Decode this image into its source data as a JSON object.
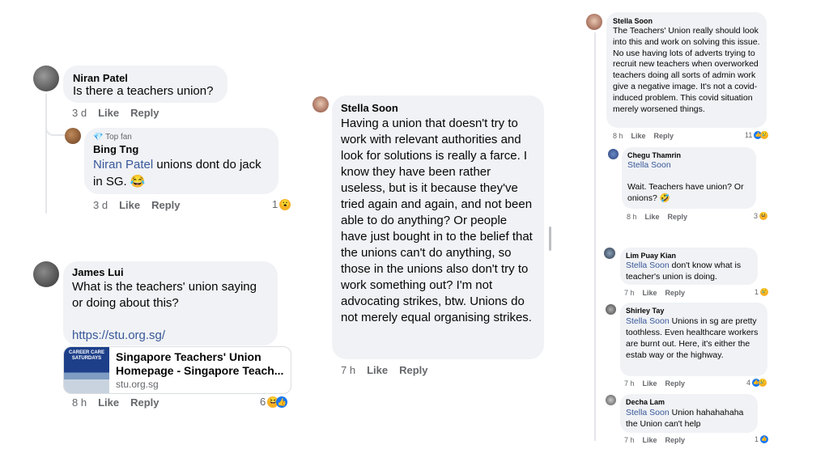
{
  "left": {
    "niran": {
      "name": "Niran Patel",
      "text": "Is there a teachers union?",
      "time": "3 d",
      "like": "Like",
      "reply": "Reply"
    },
    "bing": {
      "badge": "Top fan",
      "name": "Bing Tng",
      "mention": "Niran Patel",
      "text": " unions dont do jack in SG. 😂",
      "time": "3 d",
      "like": "Like",
      "reply": "Reply",
      "react_count": "1"
    },
    "james": {
      "name": "James Lui",
      "text": "What is the teachers' union saying or doing about this?",
      "url": "https://stu.org.sg/",
      "card_title": "Singapore Teachers' Union Homepage - Singapore Teach...",
      "card_domain": "stu.org.sg",
      "thumb_text": "CAREER CARE SATURDAYS",
      "time": "8 h",
      "like": "Like",
      "reply": "Reply",
      "react_count": "6"
    }
  },
  "middle": {
    "name": "Stella Soon",
    "text": "Having a union that doesn't try to work with relevant authorities and look for solutions is really a farce. I know they have been rather useless, but is it because they've tried again and again, and not been able to do anything? Or people have just bought in to the belief that the unions can't do anything, so those in the unions also don't try to work something out? I'm not advocating strikes, btw. Unions do not merely equal organising strikes.",
    "time": "7 h",
    "like": "Like",
    "reply": "Reply"
  },
  "right": {
    "stella": {
      "name": "Stella Soon",
      "text": "The Teachers' Union really should look into this and work on solving this issue. No use having lots of adverts trying to recruit new teachers when overworked teachers doing all sorts of admin work give a negative image. It's not a covid-induced problem. This covid situation merely worsened things.",
      "time": "8 h",
      "like": "Like",
      "reply": "Reply",
      "react_count": "11"
    },
    "chegu": {
      "name": "Chegu Thamrin",
      "mention": "Stella Soon",
      "text": "Wait. Teachers have union? Or onions? 🤣",
      "time": "8 h",
      "like": "Like",
      "reply": "Reply",
      "react_count": "3"
    },
    "lim": {
      "name": "Lim Puay Kian",
      "mention": "Stella Soon",
      "text": " don't know what is teacher's union is doing.",
      "time": "7 h",
      "like": "Like",
      "reply": "Reply",
      "react_count": "1"
    },
    "shirley": {
      "name": "Shirley Tay",
      "mention": "Stella Soon",
      "text": " Unions in sg are pretty toothless. Even healthcare workers are burnt out. Here, it's either the estab way or the highway.",
      "time": "7 h",
      "like": "Like",
      "reply": "Reply",
      "react_count": "4"
    },
    "decha": {
      "name": "Decha Lam",
      "mention": "Stella Soon",
      "text": " Union hahahahaha the Union can't help",
      "time": "7 h",
      "like": "Like",
      "reply": "Reply",
      "react_count": "1"
    }
  },
  "colors": {
    "bubble": "#f0f2f5",
    "link": "#385898",
    "meta": "#65676b",
    "like": "#1877f2",
    "emoji": "#f7b125"
  }
}
